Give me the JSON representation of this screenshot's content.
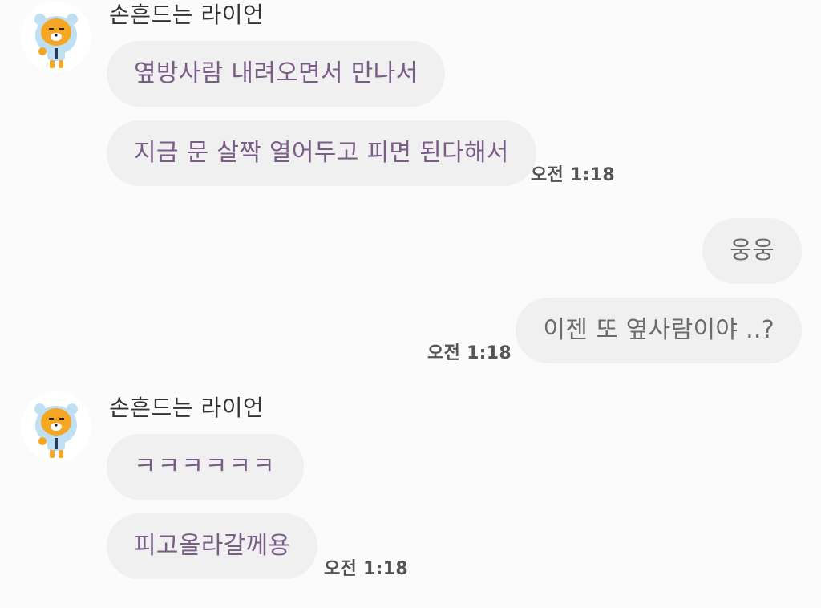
{
  "conversation": {
    "groups": [
      {
        "sender": "손흔드는 라이언",
        "avatar_icon": "ryan-character-avatar-icon",
        "messages": [
          "옆방사람 내려오면서 만나서",
          "지금 문 살짝 열어두고 피면 된다해서"
        ],
        "time": "오전 1:18"
      },
      {
        "sender": "me",
        "messages": [
          "웅웅",
          "이젠 또 옆사람이야 ..?"
        ],
        "time": "오전 1:18"
      },
      {
        "sender": "손흔드는 라이언",
        "avatar_icon": "ryan-character-avatar-icon",
        "messages": [
          "ㅋㅋㅋㅋㅋㅋ",
          "피고올라갈께용"
        ],
        "time": "오전 1:18"
      }
    ]
  },
  "colors": {
    "background": "#fbfbfb",
    "bubble": "#f0f0f1",
    "incoming_text": "#7a5d86",
    "outgoing_text": "#6b6b6b",
    "timestamp": "#555555",
    "sender_name": "#333333"
  }
}
